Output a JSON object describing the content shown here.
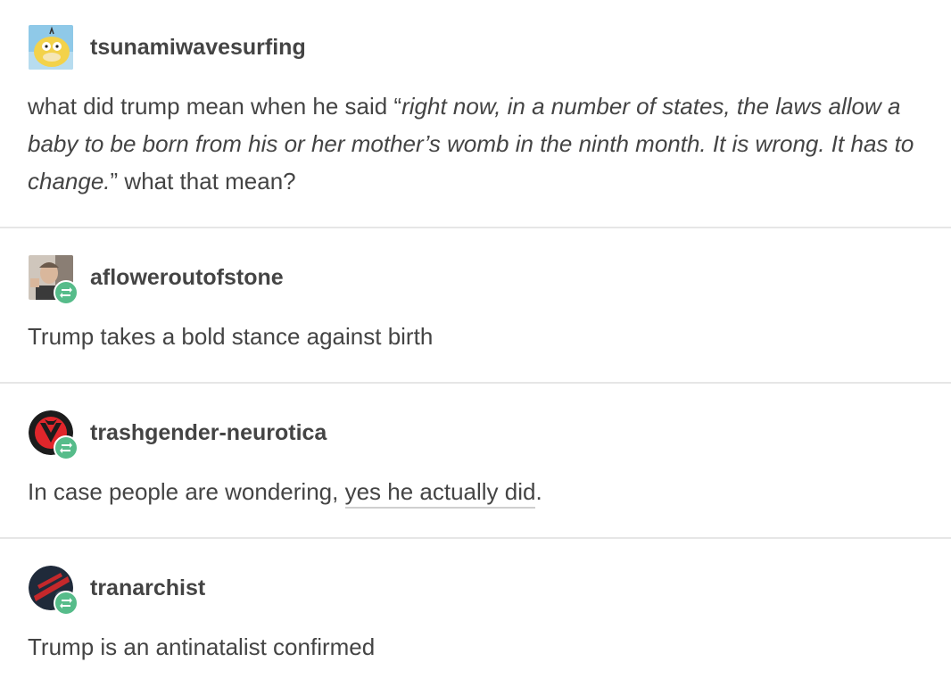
{
  "posts": [
    {
      "username": "tsunamiwavesurfing",
      "avatar": "psyduck-avatar",
      "reblog": false,
      "text_before": "what did trump mean when he said “",
      "text_quote": "right now, in a number of states, the laws allow a baby to be born from his or her mother’s womb in the ninth month. It is wrong. It has to change.",
      "text_after": "” what that mean?"
    },
    {
      "username": "afloweroutofstone",
      "avatar": "portrait-avatar",
      "reblog": true,
      "text": "Trump takes a bold stance against birth"
    },
    {
      "username": "trashgender-neurotica",
      "avatar": "red-emblem-avatar",
      "reblog": true,
      "text_before": "In case people are wondering, ",
      "link_text": "yes he actually did",
      "text_after": "."
    },
    {
      "username": "tranarchist",
      "avatar": "dark-flag-avatar",
      "reblog": true,
      "text": "Trump is an antinatalist confirmed"
    }
  ],
  "colors": {
    "text": "#444444",
    "divider": "#e6e6e6",
    "reblog_badge": "#56bc8a"
  }
}
